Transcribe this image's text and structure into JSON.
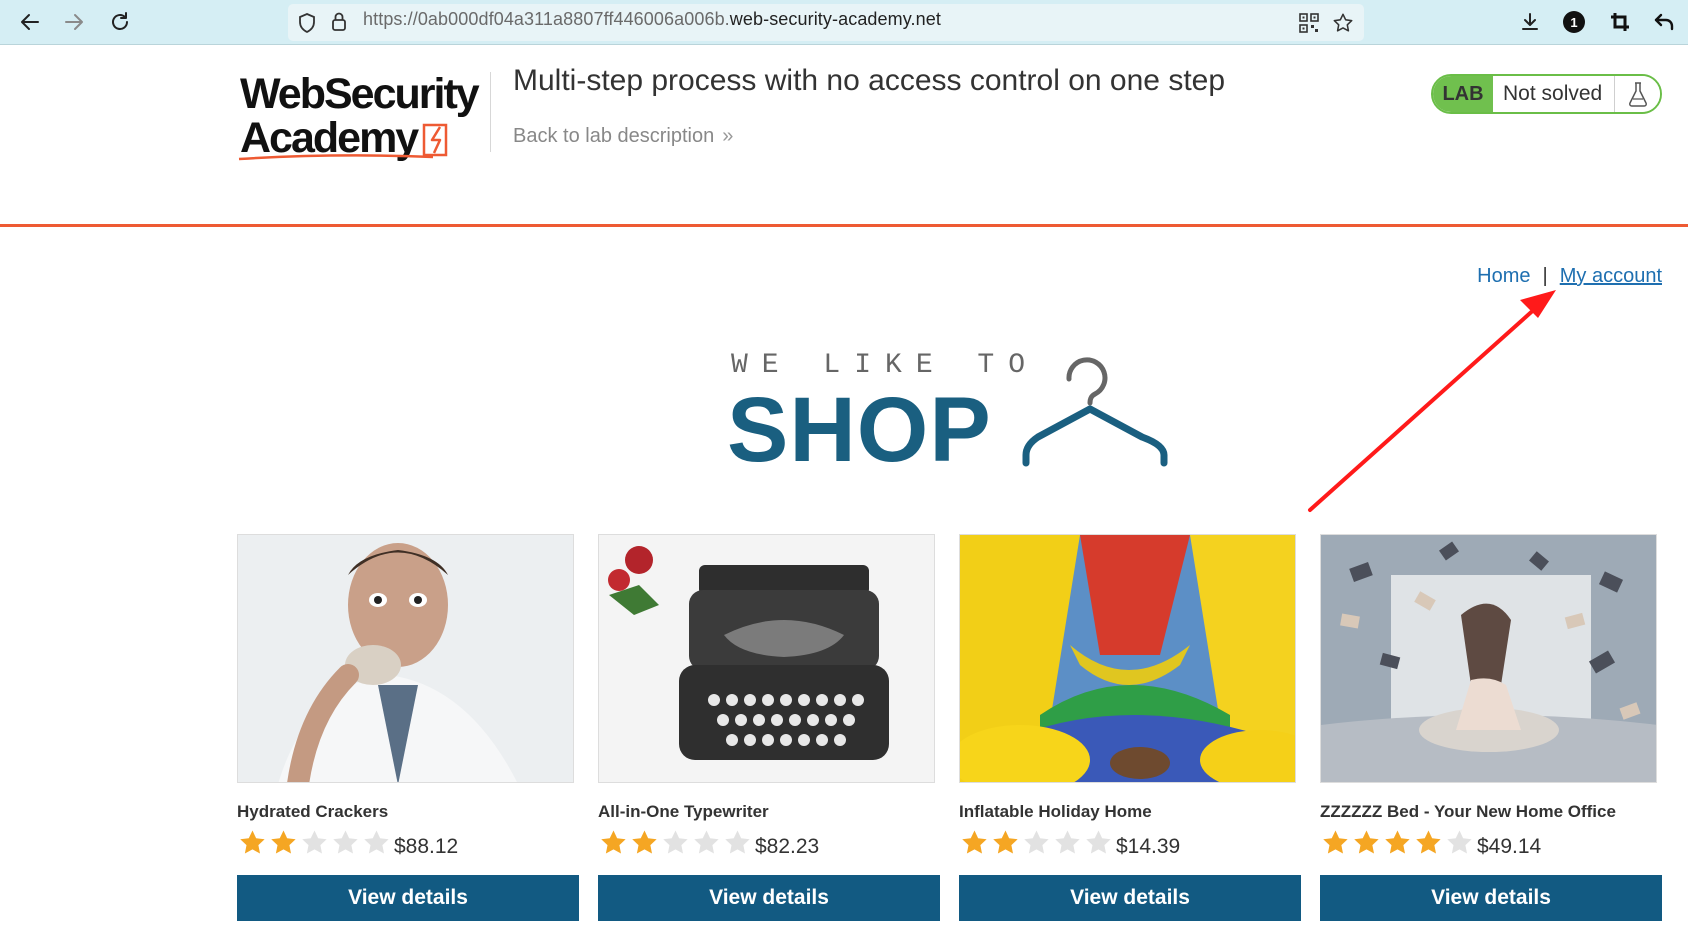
{
  "browser": {
    "url_dim": "https://0ab000df04a311a8807ff446006a006b.",
    "url_domain": "web-security-academy.net",
    "extension_badge": "1"
  },
  "lab_header": {
    "logo_line1": "WebSecurity",
    "logo_line2": "Academy",
    "title": "Multi-step process with no access control on one step",
    "back_link": "Back to lab description",
    "back_chevron": "»",
    "badge_lab": "LAB",
    "badge_status": "Not solved"
  },
  "colors": {
    "accent_orange": "#ee5a33",
    "shop_blue": "#1a5f80",
    "button_blue": "#125a82",
    "lab_green": "#70c04e",
    "star_gold": "#f5a623",
    "star_gray": "#e2e2e2",
    "arrow_red": "#ff1a1a"
  },
  "site_nav": {
    "home": "Home",
    "separator": "|",
    "my_account": "My account"
  },
  "hero": {
    "tagline": "WE LIKE TO",
    "word": "SHOP"
  },
  "products": [
    {
      "name": "Hydrated Crackers",
      "rating": 2,
      "max_rating": 5,
      "price": "$88.12",
      "button": "View details"
    },
    {
      "name": "All-in-One Typewriter",
      "rating": 2,
      "max_rating": 5,
      "price": "$82.23",
      "button": "View details"
    },
    {
      "name": "Inflatable Holiday Home",
      "rating": 2,
      "max_rating": 5,
      "price": "$14.39",
      "button": "View details"
    },
    {
      "name": "ZZZZZZ Bed - Your New Home Office",
      "rating": 4,
      "max_rating": 5,
      "price": "$49.14",
      "button": "View details"
    }
  ]
}
